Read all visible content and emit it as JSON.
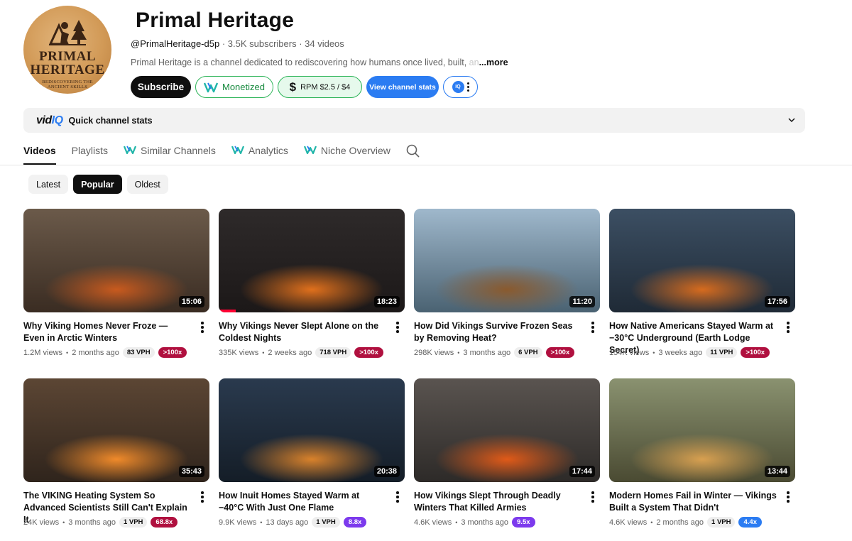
{
  "channel": {
    "avatar_text": {
      "line1": "PRIMAL",
      "line2": "HERITAGE",
      "line3": "REDISCOVERING THE ANCIENT SKILLS"
    },
    "name": "Primal Heritage",
    "handle": "@PrimalHeritage-d5p",
    "stats": " · 3.5K subscribers · 34 videos",
    "description": "Primal Heritage is a channel dedicated to rediscovering how humans once lived, built, ",
    "description_fade": "an",
    "more_label": "...more"
  },
  "buttons": {
    "subscribe": "Subscribe",
    "monetized": "Monetized",
    "rpm": "RPM $2.5 / $4",
    "rpm_icon": "$",
    "view_stats": "View channel stats",
    "iq": "IQ"
  },
  "vidiq_bar": {
    "logo_prefix": "vid",
    "logo_suffix": "IQ",
    "label": "Quick channel stats"
  },
  "tabs": {
    "videos": "Videos",
    "playlists": "Playlists",
    "similar": "Similar Channels",
    "analytics": "Analytics",
    "niche": "Niche Overview"
  },
  "chips": {
    "latest": "Latest",
    "popular": "Popular",
    "oldest": "Oldest"
  },
  "videos": [
    {
      "title": "Why Viking Homes Never Froze — Even in Arctic Winters",
      "views": "1.2M views",
      "age": "2 months ago",
      "vph": "83 VPH",
      "outlier": ">100x",
      "outlier_color": "#b0103f",
      "duration": "15:06"
    },
    {
      "title": "Why Vikings Never Slept Alone on the Coldest Nights",
      "views": "335K views",
      "age": "2 weeks ago",
      "vph": "718 VPH",
      "outlier": ">100x",
      "outlier_color": "#b0103f",
      "duration": "18:23",
      "progress": 0.09
    },
    {
      "title": "How Did Vikings Survive Frozen Seas by Removing Heat?",
      "views": "298K views",
      "age": "3 months ago",
      "vph": "6 VPH",
      "outlier": ">100x",
      "outlier_color": "#b0103f",
      "duration": "11:20"
    },
    {
      "title": "How Native Americans Stayed Warm at −30°C Underground (Earth Lodge Secret)",
      "views": "154K views",
      "age": "3 weeks ago",
      "vph": "11 VPH",
      "outlier": ">100x",
      "outlier_color": "#b0103f",
      "duration": "17:56"
    },
    {
      "title": "The VIKING Heating System So Advanced Scientists Still Can't Explain It",
      "views": "24K views",
      "age": "3 months ago",
      "vph": "1 VPH",
      "outlier": "68.8x",
      "outlier_color": "#b0103f",
      "duration": "35:43"
    },
    {
      "title": "How Inuit Homes Stayed Warm at −40°C With Just One Flame",
      "views": "9.9K views",
      "age": "13 days ago",
      "vph": "1 VPH",
      "outlier": "8.8x",
      "outlier_color": "#7c3aed",
      "duration": "20:38"
    },
    {
      "title": "How Vikings Slept Through Deadly Winters That Killed Armies",
      "views": "4.6K views",
      "age": "3 months ago",
      "vph": "",
      "outlier": "9.5x",
      "outlier_color": "#7c3aed",
      "duration": "17:44"
    },
    {
      "title": "Modern Homes Fail in Winter — Vikings Built a System That Didn't",
      "views": "4.6K views",
      "age": "2 months ago",
      "vph": "1 VPH",
      "outlier": "4.4x",
      "outlier_color": "#2b7cf2",
      "duration": "13:44"
    }
  ],
  "thumb_palettes": [
    [
      "#6b5a4a",
      "#3a2c22",
      "#c85a1e"
    ],
    [
      "#2e2a2a",
      "#1c1818",
      "#e0701c"
    ],
    [
      "#9fb8cc",
      "#4a6272",
      "#8a5a2e"
    ],
    [
      "#3c4f63",
      "#1f2a36",
      "#d66b1e"
    ],
    [
      "#5c4634",
      "#2f241c",
      "#f08a2a"
    ],
    [
      "#2a3a4e",
      "#141d27",
      "#d9822b"
    ],
    [
      "#5a5450",
      "#2d2a28",
      "#e05a18"
    ],
    [
      "#8a9270",
      "#4a4a32",
      "#d8a050"
    ]
  ]
}
